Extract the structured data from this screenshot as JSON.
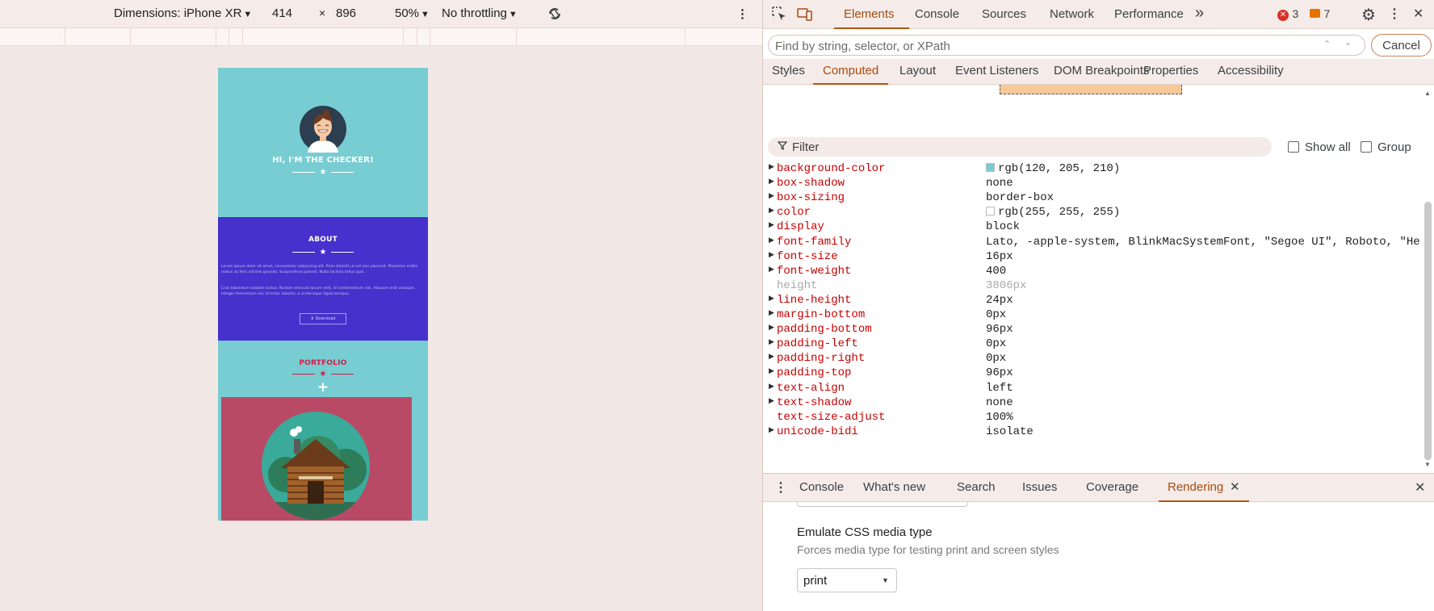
{
  "device_toolbar": {
    "dimensions_label": "Dimensions: iPhone XR",
    "width": "414",
    "times": "×",
    "height": "896",
    "zoom": "50%",
    "throttling": "No throttling"
  },
  "site": {
    "hero_title": "HI, I'M THE CHECKER!",
    "about_title": "ABOUT",
    "about_p1": "Lorem ipsum dolor sit amet, consectetur adipiscing elit. Proin blandit ut est non placerat. Phasellus mollis metus ac felis ultrices gravida. Suspendisse potenti. Nulla facilisis tellus quis.",
    "about_p2": "Cras bibendum sodales luctus. Nullam vehicula ipsum velit, id condimentum nisi. Aliquam erat volutpat. Integer fermentum nisi id tortor lobortis, a scelerisque ligula tempus.",
    "about_button": "⬇ Download",
    "portfolio_title": "PORTFOLIO",
    "plus": "+",
    "star": "★"
  },
  "devtools": {
    "main_tabs": [
      "Elements",
      "Console",
      "Sources",
      "Network",
      "Performance"
    ],
    "more_tabs": "»",
    "errors_count": "3",
    "messages_count": "7",
    "search": {
      "placeholder": "Find by string, selector, or XPath",
      "cancel": "Cancel"
    },
    "sub_tabs": [
      "Styles",
      "Computed",
      "Layout",
      "Event Listeners",
      "DOM Breakpoints",
      "Properties",
      "Accessibility"
    ],
    "filter": {
      "placeholder": "Filter",
      "show_all": "Show all",
      "group": "Group"
    },
    "computed": [
      {
        "name": "background-color",
        "value": "rgb(120, 205, 210)",
        "swatch": "#78cdd2"
      },
      {
        "name": "box-shadow",
        "value": "none"
      },
      {
        "name": "box-sizing",
        "value": "border-box"
      },
      {
        "name": "color",
        "value": "rgb(255, 255, 255)",
        "swatch": "#ffffff"
      },
      {
        "name": "display",
        "value": "block"
      },
      {
        "name": "font-family",
        "value": "Lato, -apple-system, BlinkMacSystemFont, \"Segoe UI\", Roboto, \"Hel"
      },
      {
        "name": "font-size",
        "value": "16px"
      },
      {
        "name": "font-weight",
        "value": "400"
      },
      {
        "name": "height",
        "value": "3806px",
        "inherited": true
      },
      {
        "name": "line-height",
        "value": "24px"
      },
      {
        "name": "margin-bottom",
        "value": "0px"
      },
      {
        "name": "padding-bottom",
        "value": "96px"
      },
      {
        "name": "padding-left",
        "value": "0px"
      },
      {
        "name": "padding-right",
        "value": "0px"
      },
      {
        "name": "padding-top",
        "value": "96px"
      },
      {
        "name": "text-align",
        "value": "left"
      },
      {
        "name": "text-shadow",
        "value": "none"
      },
      {
        "name": "text-size-adjust",
        "value": "100%",
        "no_expand": true
      },
      {
        "name": "unicode-bidi",
        "value": "isolate"
      }
    ],
    "drawer_tabs": [
      "Console",
      "What's new",
      "Search",
      "Issues",
      "Coverage",
      "Rendering"
    ],
    "rendering": {
      "media_title": "Emulate CSS media type",
      "media_desc": "Forces media type for testing print and screen styles",
      "media_value": "print"
    },
    "colors": {
      "accent": "#a64b0f",
      "prop_name": "#c80000",
      "error": "#d93025",
      "warning": "#e37400"
    }
  }
}
